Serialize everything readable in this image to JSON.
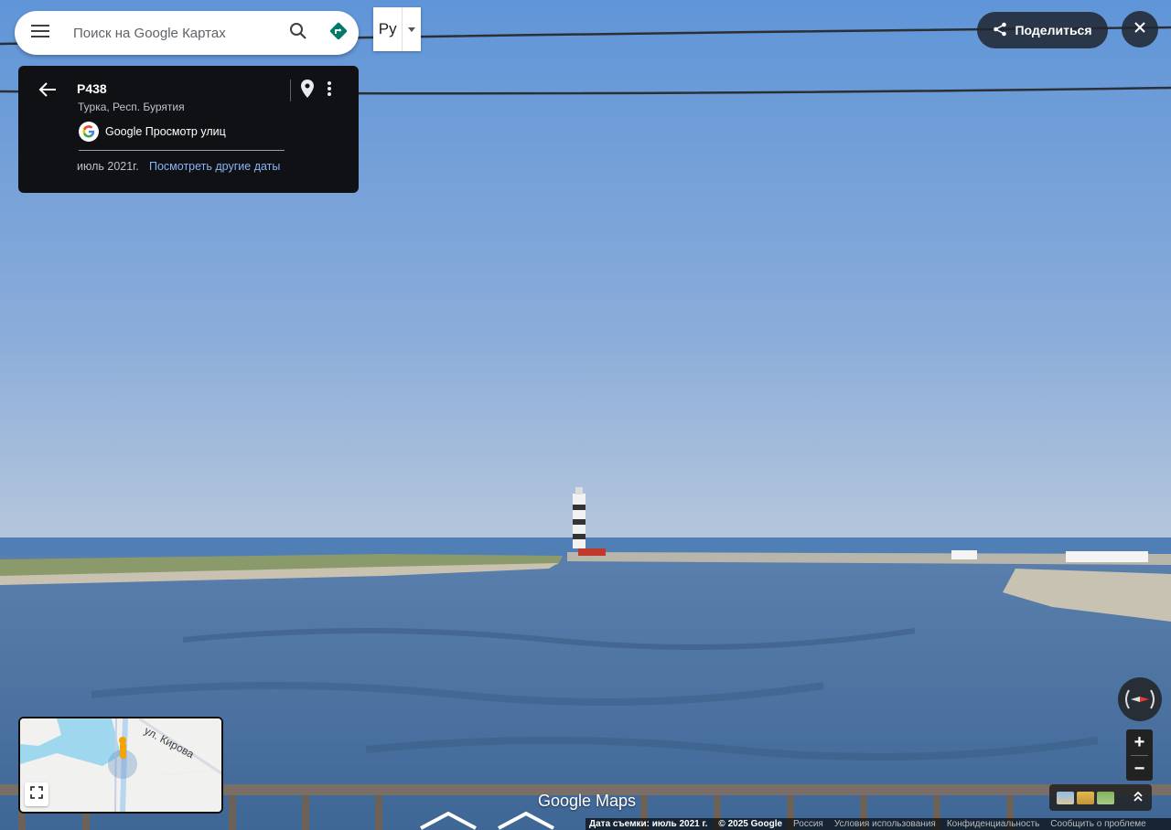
{
  "search": {
    "placeholder": "Поиск на Google Картах"
  },
  "language": {
    "label": "Ру"
  },
  "card": {
    "title": "Р438",
    "subtitle": "Турка, Респ. Бурятия",
    "service": "Google Просмотр улиц",
    "date": "июль 2021г.",
    "other_dates": "Посмотреть другие даты"
  },
  "share": {
    "label": "Поделиться"
  },
  "minimap": {
    "street": "ул. Кирова"
  },
  "watermark": "Google Maps",
  "footer": {
    "capture": "Дата съемки: июль 2021 г.",
    "copyright": "© 2025 Google",
    "country": "Россия",
    "terms": "Условия использования",
    "privacy": "Конфиденциальность",
    "report": "Сообщить о проблеме"
  },
  "colors": {
    "accent_directions": "#00796b",
    "link": "#8ab4f8",
    "card_bg": "#0f1114"
  }
}
